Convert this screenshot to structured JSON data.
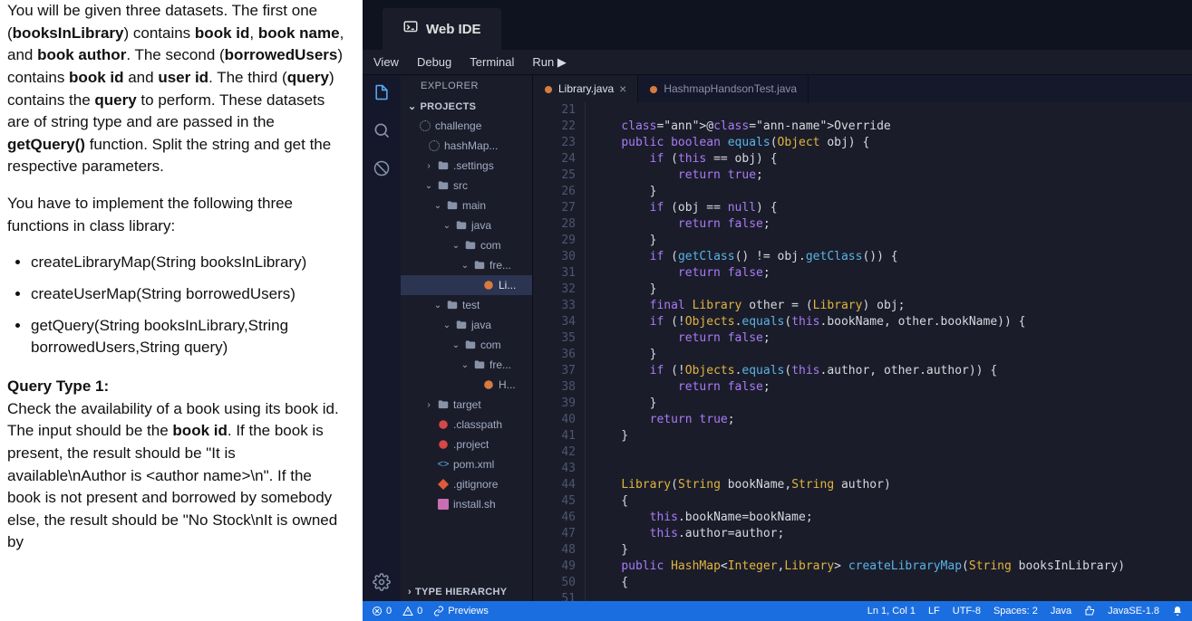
{
  "instructions": {
    "p1_pre": "You will be given three datasets. The first one (",
    "p1_b1": "booksInLibrary",
    "p1_mid1": ") contains ",
    "p1_b2": "book id",
    "p1_mid2": ", ",
    "p1_b3": "book name",
    "p1_mid3": ", and ",
    "p1_b4": "book author",
    "p1_mid4": ". The second (",
    "p1_b5": "borrowedUsers",
    "p1_mid5": ") contains ",
    "p1_b6": "book id",
    "p1_mid6": " and ",
    "p1_b7": "user id",
    "p1_mid7": ". The third (",
    "p1_b8": "query",
    "p1_mid8": ") contains the ",
    "p1_b9": "query",
    "p1_mid9": " to perform. These datasets are of string type and are passed in the ",
    "p1_b10": "getQuery()",
    "p1_mid10": " function. Split the string and get the respective parameters.",
    "p2": "You have to implement the following three functions in class library:",
    "items": [
      "createLibraryMap(String booksInLibrary)",
      "createUserMap(String borrowedUsers)",
      "getQuery(String booksInLibrary,String borrowedUsers,String query)"
    ],
    "q_title": "Query Type 1:",
    "q_pre": "        Check the availability of a book using its book id. The input should be the ",
    "q_b1": "book id",
    "q_mid": ". If the book is present, the result should be \"It is available\\nAuthor is <author name>\\n\". If the book is not present and borrowed by somebody else, the result should be \"No Stock\\nIt is owned by"
  },
  "ide": {
    "title": "Web IDE",
    "menus": [
      "View",
      "Debug",
      "Terminal",
      "Run ▶"
    ],
    "sidebar_title": "EXPLORER",
    "sections": {
      "projects": "PROJECTS",
      "type_hierarchy": "TYPE HIERARCHY"
    },
    "tree": [
      {
        "indent": 0,
        "arrow": "",
        "icon": "spinner",
        "name": "challenge"
      },
      {
        "indent": 1,
        "arrow": "",
        "icon": "spinner",
        "name": "hashMap..."
      },
      {
        "indent": 2,
        "arrow": "›",
        "icon": "folder",
        "name": ".settings"
      },
      {
        "indent": 2,
        "arrow": "⌄",
        "icon": "folder",
        "name": "src"
      },
      {
        "indent": 3,
        "arrow": "⌄",
        "icon": "folder",
        "name": "main"
      },
      {
        "indent": 4,
        "arrow": "⌄",
        "icon": "folder",
        "name": "java"
      },
      {
        "indent": 5,
        "arrow": "⌄",
        "icon": "folder",
        "name": "com"
      },
      {
        "indent": 6,
        "arrow": "⌄",
        "icon": "folder",
        "name": "fre..."
      },
      {
        "indent": 7,
        "arrow": "",
        "icon": "java",
        "name": "Li...",
        "selected": true
      },
      {
        "indent": 3,
        "arrow": "⌄",
        "icon": "folder",
        "name": "test"
      },
      {
        "indent": 4,
        "arrow": "⌄",
        "icon": "folder",
        "name": "java"
      },
      {
        "indent": 5,
        "arrow": "⌄",
        "icon": "folder",
        "name": "com"
      },
      {
        "indent": 6,
        "arrow": "⌄",
        "icon": "folder",
        "name": "fre..."
      },
      {
        "indent": 7,
        "arrow": "",
        "icon": "java",
        "name": "H..."
      },
      {
        "indent": 2,
        "arrow": "›",
        "icon": "folder",
        "name": "target"
      },
      {
        "indent": 2,
        "arrow": "",
        "icon": "red",
        "name": ".classpath"
      },
      {
        "indent": 2,
        "arrow": "",
        "icon": "red",
        "name": ".project"
      },
      {
        "indent": 2,
        "arrow": "",
        "icon": "xml",
        "name": "pom.xml"
      },
      {
        "indent": 2,
        "arrow": "",
        "icon": "git",
        "name": ".gitignore"
      },
      {
        "indent": 2,
        "arrow": "",
        "icon": "sh",
        "name": "install.sh"
      }
    ],
    "tabs": [
      {
        "name": "Library.java",
        "active": true,
        "closable": true
      },
      {
        "name": "HashmapHandsonTest.java",
        "active": false,
        "closable": false
      }
    ],
    "gutter_start": 21,
    "gutter_end": 51,
    "code": [
      "",
      "    @Override",
      "    public boolean equals(Object obj) {",
      "        if (this == obj) {",
      "            return true;",
      "        }",
      "        if (obj == null) {",
      "            return false;",
      "        }",
      "        if (getClass() != obj.getClass()) {",
      "            return false;",
      "        }",
      "        final Library other = (Library) obj;",
      "        if (!Objects.equals(this.bookName, other.bookName)) {",
      "            return false;",
      "        }",
      "        if (!Objects.equals(this.author, other.author)) {",
      "            return false;",
      "        }",
      "        return true;",
      "    }",
      "",
      "",
      "    Library(String bookName,String author)",
      "    {",
      "        this.bookName=bookName;",
      "        this.author=author;",
      "    }",
      "    public HashMap<Integer,Library> createLibraryMap(String booksInLibrary)",
      "    {",
      ""
    ],
    "status": {
      "errors": "0",
      "warnings": "0",
      "previews": "Previews",
      "ln_col": "Ln 1, Col 1",
      "lf": "LF",
      "encoding": "UTF-8",
      "spaces": "Spaces: 2",
      "lang": "Java",
      "jdk": "JavaSE-1.8"
    }
  }
}
